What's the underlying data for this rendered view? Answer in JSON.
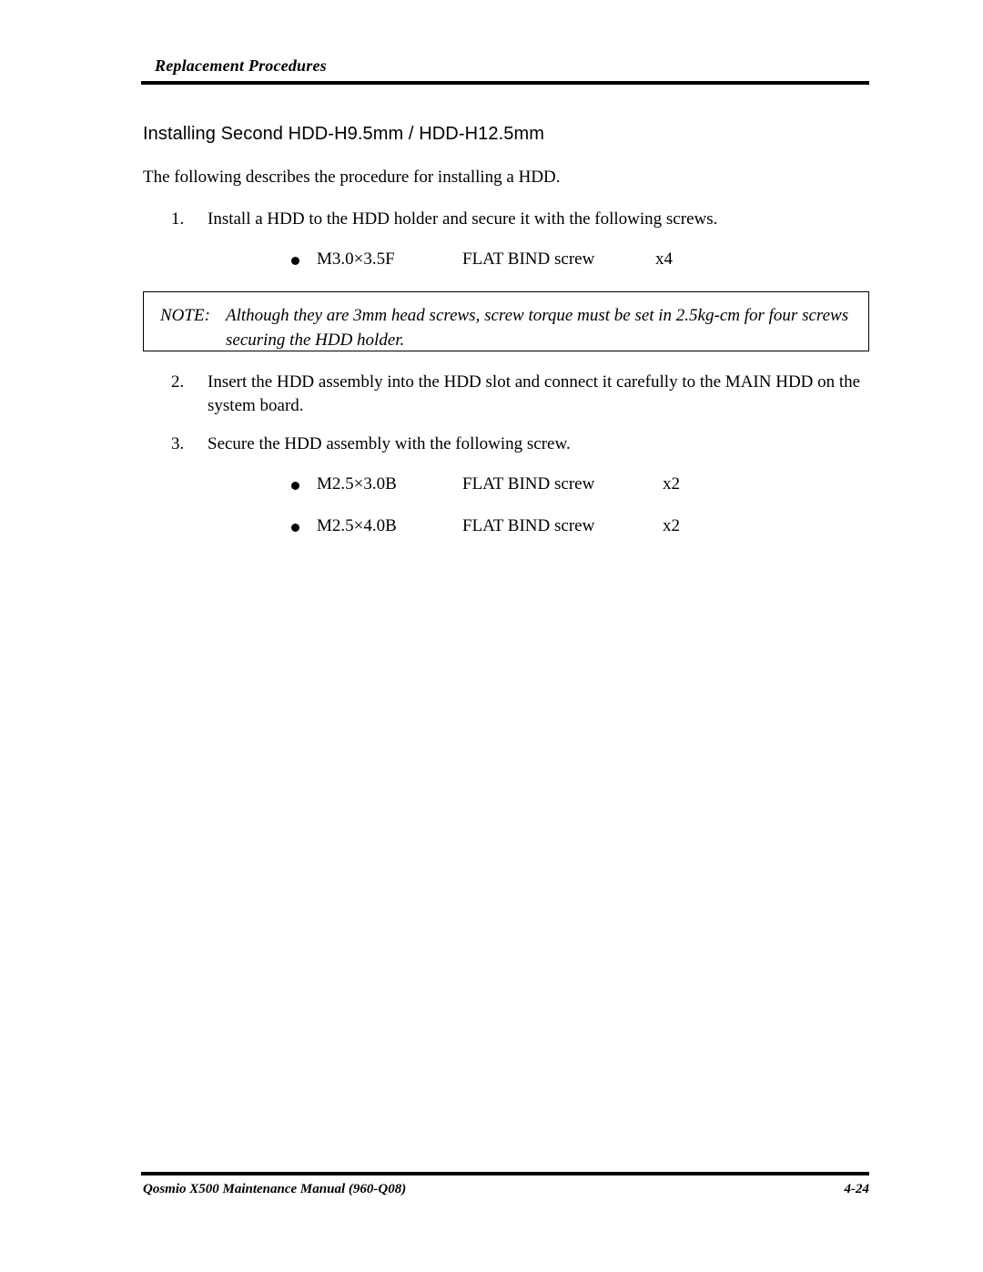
{
  "header": {
    "running_head": "Replacement Procedures"
  },
  "section": {
    "heading": "Installing Second HDD-H9.5mm / HDD-H12.5mm",
    "intro": "The following describes the procedure for installing a HDD."
  },
  "steps": [
    {
      "number": "1.",
      "text": "Install a HDD to the HDD holder and secure it with the following screws."
    },
    {
      "number": "2.",
      "text": "Insert the HDD assembly into the HDD slot and connect it carefully to the MAIN HDD on the system board."
    },
    {
      "number": "3.",
      "text": "Secure the HDD assembly with the following screw."
    }
  ],
  "screws": [
    {
      "spec": "M3.0×3.5F",
      "kind": "FLAT BIND screw",
      "qty": "x4"
    },
    {
      "spec": "M2.5×3.0B",
      "kind": "FLAT BIND screw",
      "qty": "x2"
    },
    {
      "spec": "M2.5×4.0B",
      "kind": "FLAT BIND screw",
      "qty": "x2"
    }
  ],
  "note": {
    "label": "NOTE:",
    "text": "Although they are 3mm head screws, screw torque must be set in 2.5kg-cm for four screws securing the HDD holder."
  },
  "footer": {
    "manual": "Qosmio X500 Maintenance Manual (960-Q08)",
    "page": "4-24"
  }
}
